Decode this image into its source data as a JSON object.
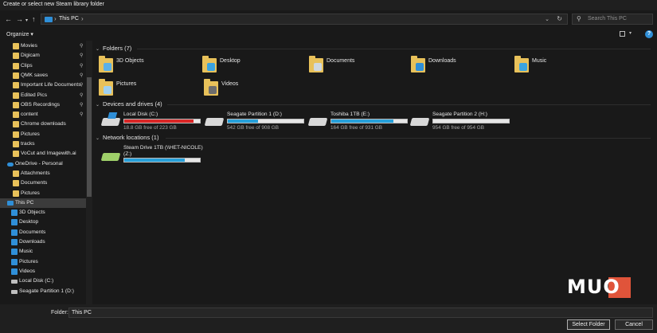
{
  "window": {
    "title": "Create or select new Steam library folder"
  },
  "address": {
    "crumb": "This PC"
  },
  "search": {
    "placeholder": "Search This PC"
  },
  "toolbar": {
    "organize": "Organize ▾"
  },
  "sidebar": {
    "items": [
      {
        "label": "Movies",
        "icon": "folder",
        "pinned": true
      },
      {
        "label": "Digicam",
        "icon": "folder",
        "pinned": true
      },
      {
        "label": "Clips",
        "icon": "folder",
        "pinned": true
      },
      {
        "label": "QMK saves",
        "icon": "folder",
        "pinned": true
      },
      {
        "label": "Important Life Documents",
        "icon": "folder",
        "pinned": true
      },
      {
        "label": "Edited Pics",
        "icon": "folder",
        "pinned": true
      },
      {
        "label": "OBS Recordings",
        "icon": "folder",
        "pinned": true
      },
      {
        "label": "content",
        "icon": "folder",
        "pinned": true
      },
      {
        "label": "Chrome downloads",
        "icon": "folder",
        "pinned": false
      },
      {
        "label": "Pictures",
        "icon": "folder",
        "pinned": false
      },
      {
        "label": "tracks",
        "icon": "folder",
        "pinned": false
      },
      {
        "label": "VoCut and Imagewith.ai",
        "icon": "folder",
        "pinned": false
      },
      {
        "label": "OneDrive - Personal",
        "icon": "cloud",
        "pinned": false
      },
      {
        "label": "Attachments",
        "icon": "folder",
        "pinned": false
      },
      {
        "label": "Documents",
        "icon": "folder",
        "pinned": false
      },
      {
        "label": "Pictures",
        "icon": "folder",
        "pinned": false
      },
      {
        "label": "This PC",
        "icon": "pc",
        "pinned": false,
        "selected": true
      },
      {
        "label": "3D Objects",
        "icon": "blue",
        "pinned": false
      },
      {
        "label": "Desktop",
        "icon": "blue",
        "pinned": false
      },
      {
        "label": "Documents",
        "icon": "blue",
        "pinned": false
      },
      {
        "label": "Downloads",
        "icon": "blue",
        "pinned": false
      },
      {
        "label": "Music",
        "icon": "blue",
        "pinned": false
      },
      {
        "label": "Pictures",
        "icon": "blue",
        "pinned": false
      },
      {
        "label": "Videos",
        "icon": "blue",
        "pinned": false
      },
      {
        "label": "Local Disk (C:)",
        "icon": "drive",
        "pinned": false
      },
      {
        "label": "Seagate Partition 1 (D:)",
        "icon": "drive",
        "pinned": false
      }
    ]
  },
  "folders": {
    "header": "Folders (7)",
    "items": [
      {
        "label": "3D Objects",
        "glyph": "#5bb0e8"
      },
      {
        "label": "Desktop",
        "glyph": "#3aa3e0"
      },
      {
        "label": "Documents",
        "glyph": "#cfd8e0"
      },
      {
        "label": "Downloads",
        "glyph": "#2f8fd8"
      },
      {
        "label": "Music",
        "glyph": "#3aa3e0"
      },
      {
        "label": "Pictures",
        "glyph": "#9fd0f0"
      },
      {
        "label": "Videos",
        "glyph": "#6d6d6d"
      }
    ]
  },
  "devices": {
    "header": "Devices and drives (4)",
    "items": [
      {
        "name": "Local Disk (C:)",
        "free": "18.8 GB free of 223 GB",
        "used_fraction": 0.916,
        "bar_color": "#da2626",
        "windows": true
      },
      {
        "name": "Seagate Partition 1 (D:)",
        "free": "542 GB free of 908 GB",
        "used_fraction": 0.403,
        "bar_color": "#26a0da",
        "windows": false
      },
      {
        "name": "Toshiba 1TB (E:)",
        "free": "164 GB free of 931 GB",
        "used_fraction": 0.824,
        "bar_color": "#26a0da",
        "windows": false
      },
      {
        "name": "Seagate Partition 2 (H:)",
        "free": "954 GB free of 954 GB",
        "used_fraction": 0.0,
        "bar_color": "#26a0da",
        "windows": false
      }
    ]
  },
  "network": {
    "header": "Network locations (1)",
    "items": [
      {
        "name": "Steam Drive 1TB (\\\\HET-NICOLE)",
        "name2": "(Z:)",
        "used_fraction": 0.8,
        "bar_color": "#26a0da"
      }
    ]
  },
  "footer": {
    "folder_label": "Folder:",
    "folder_value": "This PC",
    "select_button": "Select Folder",
    "cancel_button": "Cancel"
  },
  "watermark": {
    "text": "MUO",
    "color": "#e0543a"
  }
}
